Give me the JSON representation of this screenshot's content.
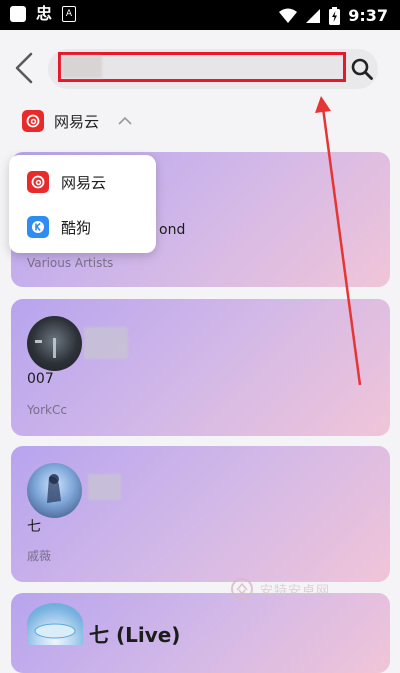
{
  "status_bar": {
    "time": "9:37",
    "left_glyph": "忠",
    "a_label": "A"
  },
  "search": {
    "value": "",
    "placeholder": ""
  },
  "source": {
    "selected": "网易云",
    "options": [
      {
        "label": "网易云",
        "icon": "netease-cloud-music-logo"
      },
      {
        "label": "酷狗",
        "icon": "kugou-logo"
      }
    ]
  },
  "results": [
    {
      "title_fragment": "ond",
      "artist": "Various Artists"
    },
    {
      "title": "007",
      "artist": "YorkCc"
    },
    {
      "title": "七",
      "artist": "戚薇"
    },
    {
      "title": "七 (Live)"
    }
  ],
  "watermark": {
    "text": "安特安卓网"
  },
  "colors": {
    "accent_red": "#e82a2a",
    "kugou_blue": "#2f8cf2",
    "highlight_border": "#e8182a"
  }
}
